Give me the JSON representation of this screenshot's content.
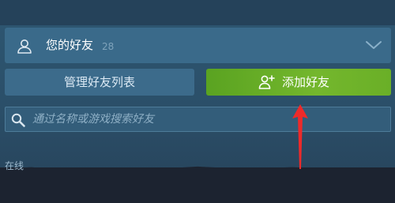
{
  "friends_header": {
    "title": "您的好友",
    "count": "28",
    "icons": {
      "user": "user-icon",
      "toggle": "chevron-down-icon"
    }
  },
  "buttons": {
    "manage_friends": "管理好友列表",
    "add_friend": "添加好友",
    "add_icon": "add-user-icon"
  },
  "search": {
    "placeholder": "通过名称或游戏搜索好友",
    "icon": "search-icon"
  },
  "sections": {
    "online": "在线"
  },
  "colors": {
    "panel": "#3a6a8a",
    "accent_green": "#6aaf27",
    "background": "#2a4a62",
    "annotation_red": "#ee2a2a"
  }
}
